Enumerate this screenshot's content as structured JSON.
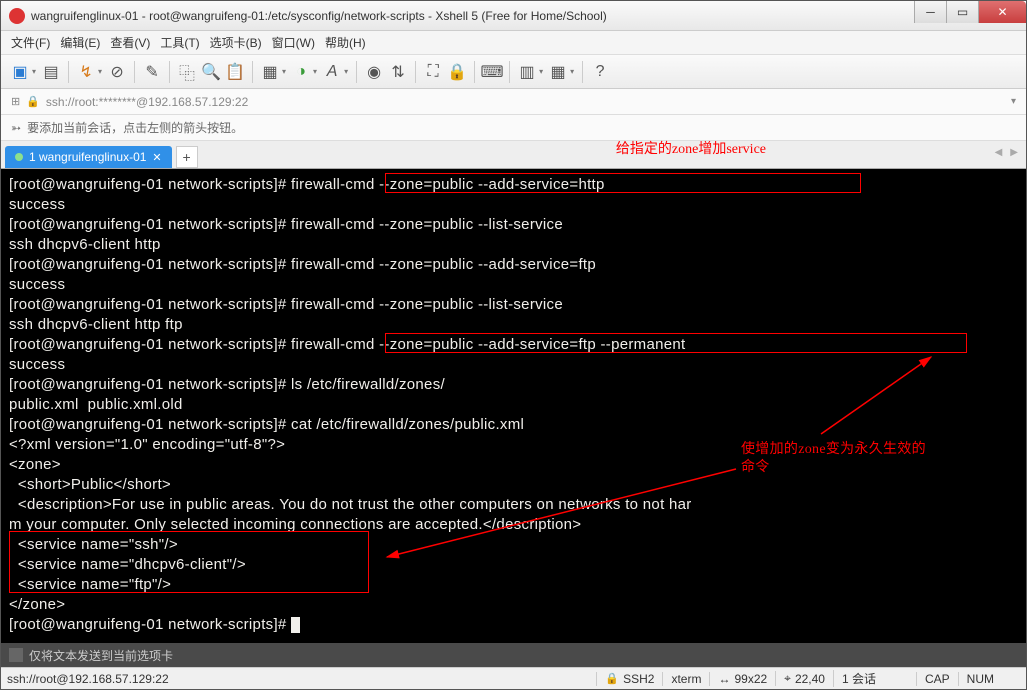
{
  "window": {
    "title": "wangruifenglinux-01 - root@wangruifeng-01:/etc/sysconfig/network-scripts - Xshell 5 (Free for Home/School)"
  },
  "menubar": {
    "file": "文件(F)",
    "edit": "编辑(E)",
    "view": "查看(V)",
    "tools": "工具(T)",
    "tabs": "选项卡(B)",
    "window": "窗口(W)",
    "help": "帮助(H)"
  },
  "addressbar": {
    "text": "ssh://root:********@192.168.57.129:22"
  },
  "hintbar": {
    "text": "要添加当前会话，点击左侧的箭头按钮。"
  },
  "tab": {
    "label": "1 wangruifenglinux-01"
  },
  "annotations": {
    "top": "给指定的zone增加service",
    "right1": "使增加的zone变为永久生效的",
    "right2": "命令"
  },
  "terminal_lines": [
    "[root@wangruifeng-01 network-scripts]# firewall-cmd --zone=public --add-service=http",
    "success",
    "[root@wangruifeng-01 network-scripts]# firewall-cmd --zone=public --list-service",
    "ssh dhcpv6-client http",
    "[root@wangruifeng-01 network-scripts]# firewall-cmd --zone=public --add-service=ftp",
    "success",
    "[root@wangruifeng-01 network-scripts]# firewall-cmd --zone=public --list-service",
    "ssh dhcpv6-client http ftp",
    "[root@wangruifeng-01 network-scripts]# firewall-cmd --zone=public --add-service=ftp --permanent",
    "success",
    "[root@wangruifeng-01 network-scripts]# ls /etc/firewalld/zones/",
    "public.xml  public.xml.old",
    "[root@wangruifeng-01 network-scripts]# cat /etc/firewalld/zones/public.xml",
    "<?xml version=\"1.0\" encoding=\"utf-8\"?>",
    "<zone>",
    "  <short>Public</short>",
    "  <description>For use in public areas. You do not trust the other computers on networks to not har",
    "m your computer. Only selected incoming connections are accepted.</description>",
    "  <service name=\"ssh\"/>",
    "  <service name=\"dhcpv6-client\"/>",
    "  <service name=\"ftp\"/>",
    "</zone>",
    "[root@wangruifeng-01 network-scripts]# "
  ],
  "send_hint": "仅将文本发送到当前选项卡",
  "statusbar": {
    "left": "ssh://root@192.168.57.129:22",
    "proto": "SSH2",
    "term": "xterm",
    "size": "99x22",
    "pos": "22,40",
    "sessions": "1 会话",
    "caps": "CAP",
    "num": "NUM"
  }
}
